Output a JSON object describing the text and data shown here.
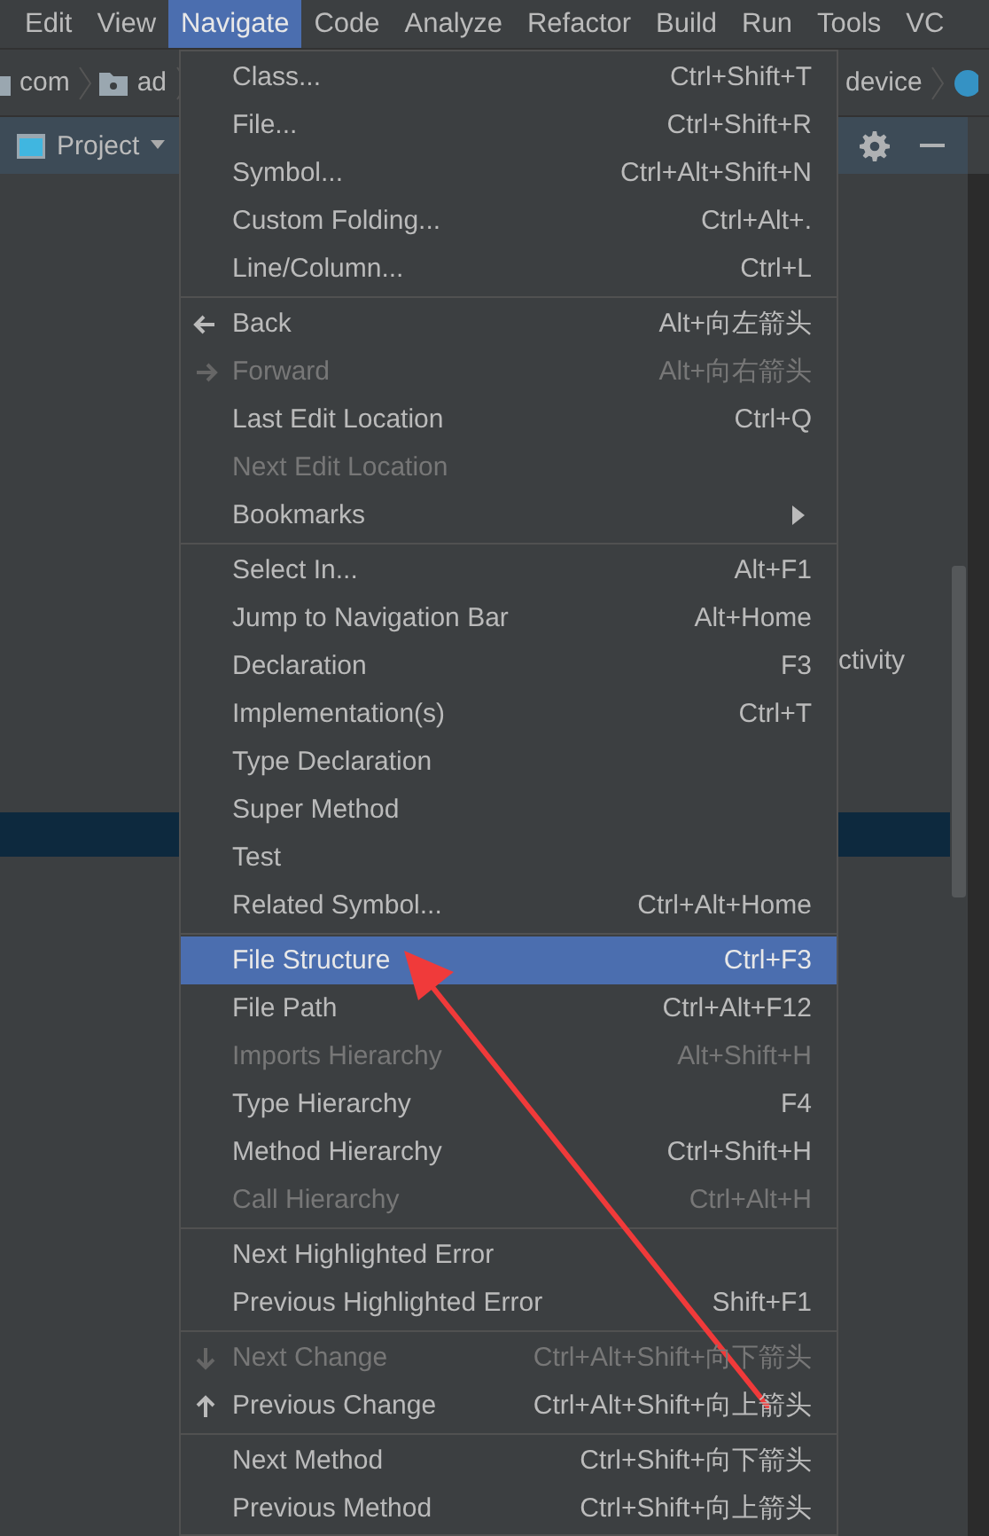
{
  "menubar": [
    {
      "label": "Edit",
      "selected": false
    },
    {
      "label": "View",
      "selected": false
    },
    {
      "label": "Navigate",
      "selected": true
    },
    {
      "label": "Code",
      "selected": false
    },
    {
      "label": "Analyze",
      "selected": false
    },
    {
      "label": "Refactor",
      "selected": false
    },
    {
      "label": "Build",
      "selected": false
    },
    {
      "label": "Run",
      "selected": false
    },
    {
      "label": "Tools",
      "selected": false
    },
    {
      "label": "VC",
      "selected": false
    }
  ],
  "breadcrumb": {
    "items": [
      {
        "label": "com"
      },
      {
        "label": "ad"
      }
    ],
    "right_item": {
      "label": "device"
    }
  },
  "project_panel": {
    "title": "Project",
    "row_text": "ctivity"
  },
  "menu": {
    "groups": [
      [
        {
          "label": "Class...",
          "shortcut": "Ctrl+Shift+T",
          "disabled": false,
          "selected": false,
          "kind": "command"
        },
        {
          "label": "File...",
          "shortcut": "Ctrl+Shift+R",
          "disabled": false,
          "selected": false,
          "kind": "command"
        },
        {
          "label": "Symbol...",
          "shortcut": "Ctrl+Alt+Shift+N",
          "disabled": false,
          "selected": false,
          "kind": "command"
        },
        {
          "label": "Custom Folding...",
          "shortcut": "Ctrl+Alt+.",
          "disabled": false,
          "selected": false,
          "kind": "command"
        },
        {
          "label": "Line/Column...",
          "shortcut": "Ctrl+L",
          "disabled": false,
          "selected": false,
          "kind": "command"
        }
      ],
      [
        {
          "label": "Back",
          "shortcut": "Alt+向左箭头",
          "disabled": false,
          "selected": false,
          "kind": "arrow-left"
        },
        {
          "label": "Forward",
          "shortcut": "Alt+向右箭头",
          "disabled": true,
          "selected": false,
          "kind": "arrow-right"
        },
        {
          "label": "Last Edit Location",
          "shortcut": "Ctrl+Q",
          "disabled": false,
          "selected": false,
          "kind": "command"
        },
        {
          "label": "Next Edit Location",
          "disabled": true,
          "selected": false,
          "kind": "command"
        },
        {
          "label": "Bookmarks",
          "disabled": false,
          "selected": false,
          "kind": "submenu"
        }
      ],
      [
        {
          "label": "Select In...",
          "shortcut": "Alt+F1",
          "disabled": false,
          "selected": false,
          "kind": "command"
        },
        {
          "label": "Jump to Navigation Bar",
          "shortcut": "Alt+Home",
          "disabled": false,
          "selected": false,
          "kind": "command"
        },
        {
          "label": "Declaration",
          "shortcut": "F3",
          "disabled": false,
          "selected": false,
          "kind": "command"
        },
        {
          "label": "Implementation(s)",
          "shortcut": "Ctrl+T",
          "disabled": false,
          "selected": false,
          "kind": "command"
        },
        {
          "label": "Type Declaration",
          "disabled": false,
          "selected": false,
          "kind": "command"
        },
        {
          "label": "Super Method",
          "disabled": false,
          "selected": false,
          "kind": "command"
        },
        {
          "label": "Test",
          "disabled": false,
          "selected": false,
          "kind": "command"
        },
        {
          "label": "Related Symbol...",
          "shortcut": "Ctrl+Alt+Home",
          "disabled": false,
          "selected": false,
          "kind": "command"
        }
      ],
      [
        {
          "label": "File Structure",
          "shortcut": "Ctrl+F3",
          "disabled": false,
          "selected": true,
          "kind": "command"
        },
        {
          "label": "File Path",
          "shortcut": "Ctrl+Alt+F12",
          "disabled": false,
          "selected": false,
          "kind": "command"
        },
        {
          "label": "Imports Hierarchy",
          "shortcut": "Alt+Shift+H",
          "disabled": true,
          "selected": false,
          "kind": "command"
        },
        {
          "label": "Type Hierarchy",
          "shortcut": "F4",
          "disabled": false,
          "selected": false,
          "kind": "command"
        },
        {
          "label": "Method Hierarchy",
          "shortcut": "Ctrl+Shift+H",
          "disabled": false,
          "selected": false,
          "kind": "command"
        },
        {
          "label": "Call Hierarchy",
          "shortcut": "Ctrl+Alt+H",
          "disabled": true,
          "selected": false,
          "kind": "command"
        }
      ],
      [
        {
          "label": "Next Highlighted Error",
          "disabled": false,
          "selected": false,
          "kind": "command"
        },
        {
          "label": "Previous Highlighted Error",
          "shortcut": "Shift+F1",
          "disabled": false,
          "selected": false,
          "kind": "command"
        }
      ],
      [
        {
          "label": "Next Change",
          "shortcut": "Ctrl+Alt+Shift+向下箭头",
          "disabled": true,
          "selected": false,
          "kind": "arrow-down"
        },
        {
          "label": "Previous Change",
          "shortcut": "Ctrl+Alt+Shift+向上箭头",
          "disabled": false,
          "selected": false,
          "kind": "arrow-up"
        }
      ],
      [
        {
          "label": "Next Method",
          "shortcut": "Ctrl+Shift+向下箭头",
          "disabled": false,
          "selected": false,
          "kind": "command"
        },
        {
          "label": "Previous Method",
          "shortcut": "Ctrl+Shift+向上箭头",
          "disabled": false,
          "selected": false,
          "kind": "command"
        }
      ]
    ]
  }
}
